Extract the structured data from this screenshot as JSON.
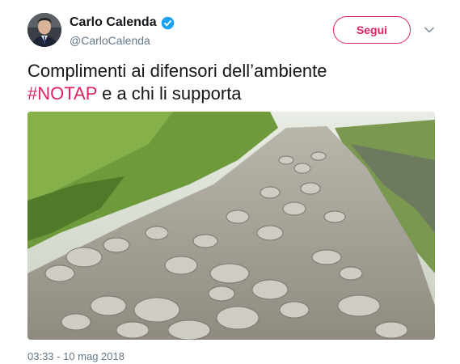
{
  "author": {
    "display_name": "Carlo Calenda",
    "handle": "@CarloCalenda",
    "verified": true,
    "avatar_icon": "user-avatar"
  },
  "follow_button": {
    "label": "Segui",
    "color": "#e0245e"
  },
  "menu": {
    "icon": "chevron-down-icon"
  },
  "tweet": {
    "text_line1": "Complimenti ai difensori dell’ambiente",
    "hashtag": "#NOTAP",
    "text_line2_rest": " e a chi li supporta"
  },
  "media": {
    "type": "video",
    "description_icon": "video-thumbnail"
  },
  "timestamp": "03:33 - 10 mag 2018",
  "colors": {
    "accent": "#e0245e",
    "verified": "#1da1f2",
    "muted": "#657786",
    "text": "#14171a"
  }
}
